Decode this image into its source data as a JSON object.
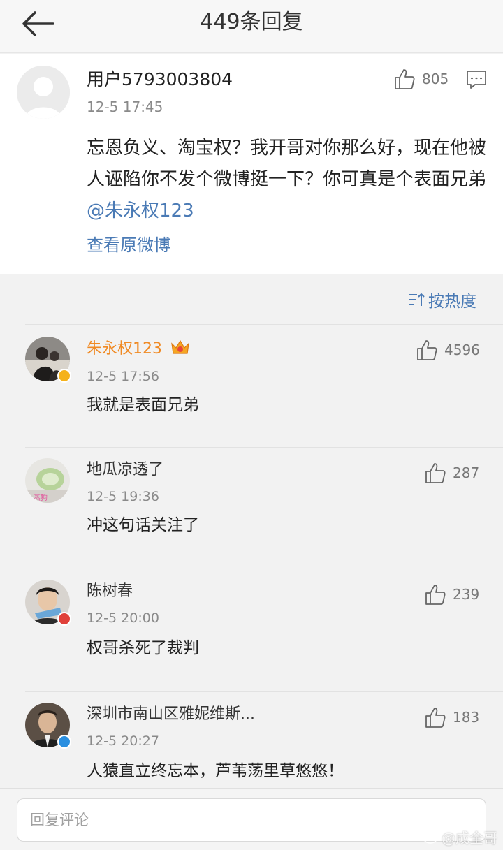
{
  "header": {
    "title": "449条回复"
  },
  "post": {
    "username": "用户5793003804",
    "time": "12-5 17:45",
    "likes": "805",
    "content_text": "忘恩负义、淘宝权？我开哥对你那么好，现在他被人诬陷你不发个微博挺一下？你可真是个表面兄弟",
    "mention": "@朱永权123",
    "view_original": "查看原微博"
  },
  "sort": {
    "label": "按热度"
  },
  "replies": [
    {
      "name": "朱永权123",
      "time": "12-5 17:56",
      "likes": "4596",
      "text": "我就是表面兄弟"
    },
    {
      "name": "地瓜凉透了",
      "time": "12-5 19:36",
      "likes": "287",
      "text": "冲这句话关注了",
      "avatar_caption": "蒸狗"
    },
    {
      "name": "陈树春",
      "time": "12-5 20:00",
      "likes": "239",
      "text": "权哥杀死了裁判"
    },
    {
      "name": "深圳市南山区雅妮维斯...",
      "time": "12-5 20:27",
      "likes": "183",
      "text": "人猿直立终忘本，芦苇荡里草悠悠！"
    }
  ],
  "input": {
    "placeholder": "回复评论"
  },
  "watermark": {
    "text": "@成全哥"
  },
  "colors": {
    "link": "#4a7ab5",
    "vip_name": "#f08a24",
    "verified_gold": "#f5b21b",
    "verified_blue": "#2a8fe0"
  }
}
